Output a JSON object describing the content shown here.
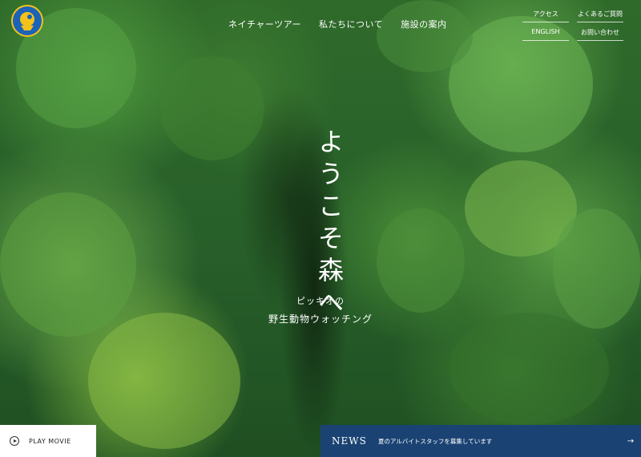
{
  "brand": {
    "logo_icon": "piccio-logo-icon"
  },
  "nav": {
    "items": [
      "ネイチャーツアー",
      "私たちについて",
      "施設の案内"
    ]
  },
  "utility": {
    "row1": [
      "アクセス",
      "よくあるご質問"
    ],
    "row2": [
      "ENGLISH",
      "お問い合わせ"
    ]
  },
  "hero": {
    "headline": "ようこそ森へ",
    "subtitle_line1": "ピッキオの",
    "subtitle_line2": "野生動物ウォッチング"
  },
  "play": {
    "label": "PLAY MOVIE",
    "icon": "play-circle-icon"
  },
  "news": {
    "title": "NEWS",
    "text": "夏のアルバイトスタッフを募集しています",
    "arrow_icon": "arrow-right-icon"
  },
  "colors": {
    "news_bg": "#1a4373",
    "logo_blue": "#1c63b8",
    "logo_yellow": "#f4c21b"
  }
}
